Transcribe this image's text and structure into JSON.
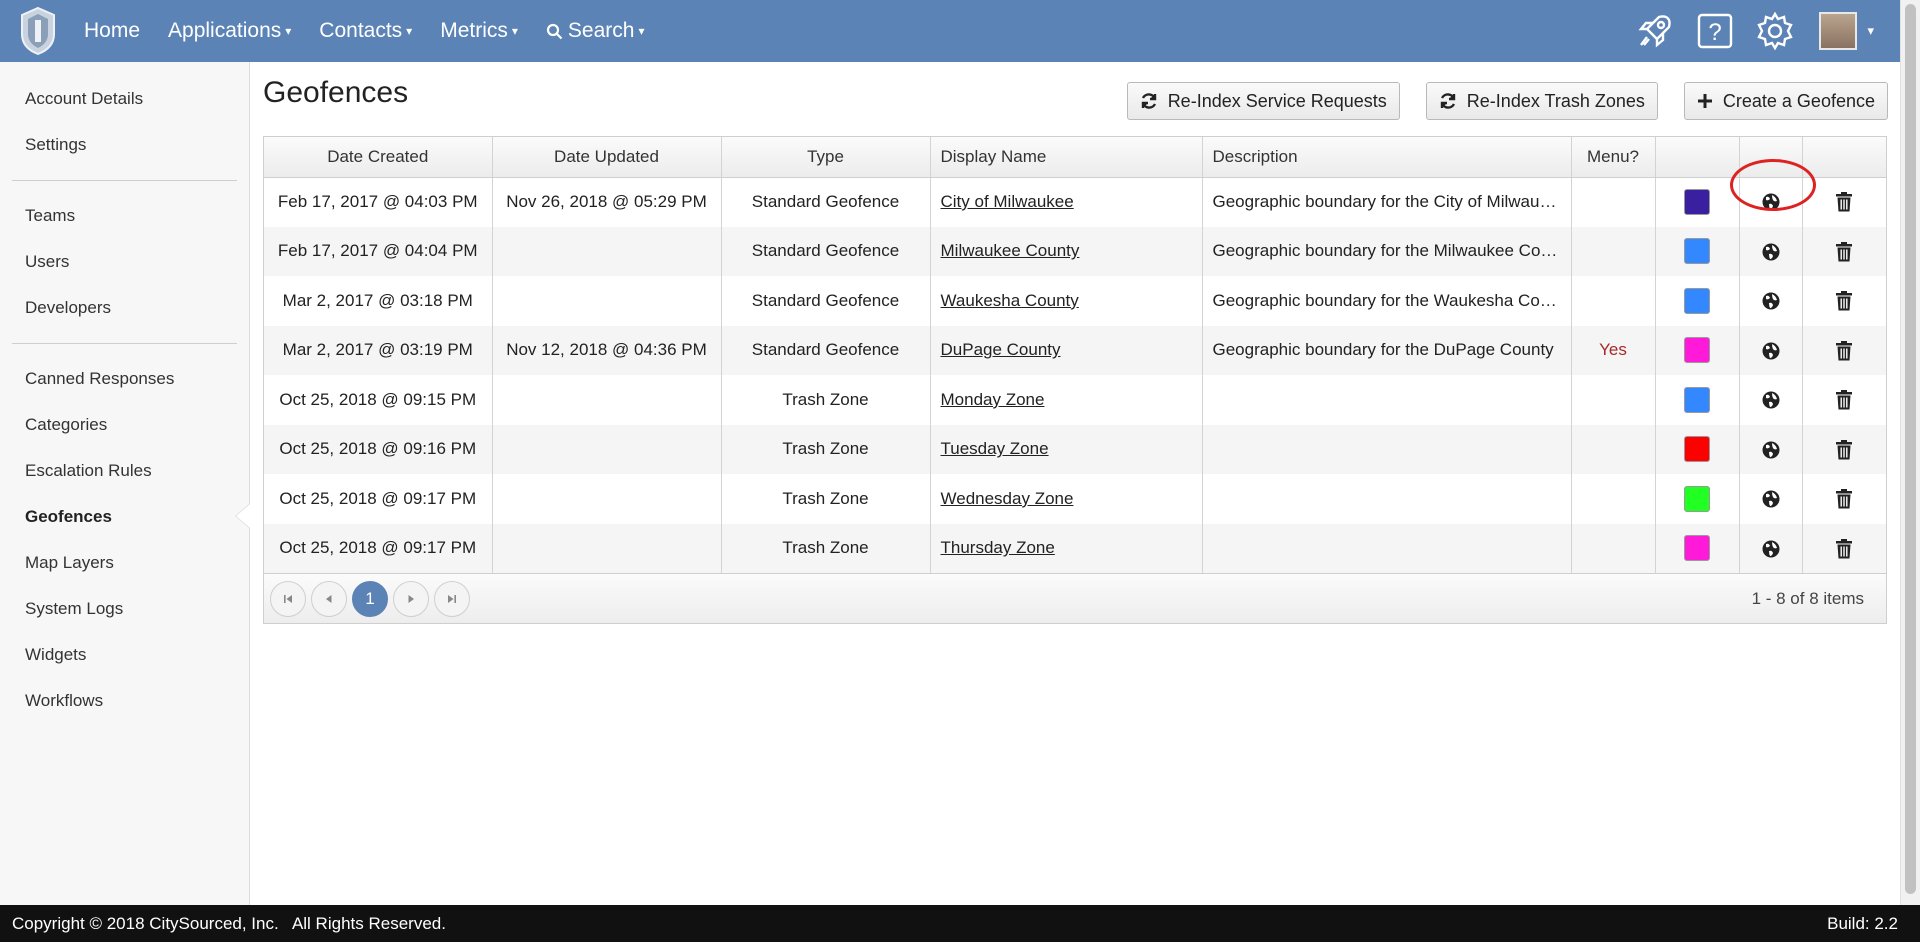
{
  "nav": {
    "items": [
      {
        "label": "Home",
        "caret": false
      },
      {
        "label": "Applications",
        "caret": true
      },
      {
        "label": "Contacts",
        "caret": true
      },
      {
        "label": "Metrics",
        "caret": true
      },
      {
        "label": "Search",
        "caret": true
      }
    ],
    "caret_glyph": "▾",
    "icons": [
      "rocket-icon",
      "help-icon",
      "gear-icon"
    ]
  },
  "sidebar": {
    "groups": [
      [
        "Account Details",
        "Settings"
      ],
      [
        "Teams",
        "Users",
        "Developers"
      ],
      [
        "Canned Responses",
        "Categories",
        "Escalation Rules",
        "Geofences",
        "Map Layers",
        "System Logs",
        "Widgets",
        "Workflows"
      ]
    ],
    "active": "Geofences"
  },
  "page": {
    "title": "Geofences",
    "buttons": {
      "reindex_requests": "Re-Index Service Requests",
      "reindex_trash": "Re-Index Trash Zones",
      "create": "Create a Geofence"
    }
  },
  "table": {
    "columns": [
      "Date Created",
      "Date Updated",
      "Type",
      "Display Name",
      "Description",
      "Menu?",
      "",
      "",
      ""
    ],
    "rows": [
      {
        "created": "Feb 17, 2017 @ 04:03 PM",
        "updated": "Nov 26, 2018 @ 05:29 PM",
        "type": "Standard Geofence",
        "name": "City of Milwaukee",
        "description": "Geographic boundary for the City of Milwaukee",
        "menu": "",
        "color": "#3a1fa0"
      },
      {
        "created": "Feb 17, 2017 @ 04:04 PM",
        "updated": "",
        "type": "Standard Geofence",
        "name": "Milwaukee County",
        "description": "Geographic boundary for the Milwaukee County",
        "menu": "",
        "color": "#3388ff"
      },
      {
        "created": "Mar 2, 2017 @ 03:18 PM",
        "updated": "",
        "type": "Standard Geofence",
        "name": "Waukesha County",
        "description": "Geographic boundary for the Waukesha County",
        "menu": "",
        "color": "#3388ff"
      },
      {
        "created": "Mar 2, 2017 @ 03:19 PM",
        "updated": "Nov 12, 2018 @ 04:36 PM",
        "type": "Standard Geofence",
        "name": "DuPage County",
        "description": "Geographic boundary for the DuPage County",
        "menu": "Yes",
        "color": "#ff1ad9"
      },
      {
        "created": "Oct 25, 2018 @ 09:15 PM",
        "updated": "",
        "type": "Trash Zone",
        "name": "Monday Zone",
        "description": "",
        "menu": "",
        "color": "#3388ff"
      },
      {
        "created": "Oct 25, 2018 @ 09:16 PM",
        "updated": "",
        "type": "Trash Zone",
        "name": "Tuesday Zone",
        "description": "",
        "menu": "",
        "color": "#ff0000"
      },
      {
        "created": "Oct 25, 2018 @ 09:17 PM",
        "updated": "",
        "type": "Trash Zone",
        "name": "Wednesday Zone",
        "description": "",
        "menu": "",
        "color": "#22ff22"
      },
      {
        "created": "Oct 25, 2018 @ 09:17 PM",
        "updated": "",
        "type": "Trash Zone",
        "name": "Thursday Zone",
        "description": "",
        "menu": "",
        "color": "#ff1ad9"
      }
    ]
  },
  "pager": {
    "current": "1",
    "info": "1 - 8 of 8 items"
  },
  "footer": {
    "copyright": "Copyright © 2018 CitySourced, Inc.   All Rights Reserved.",
    "build": "Build: 2.2"
  }
}
